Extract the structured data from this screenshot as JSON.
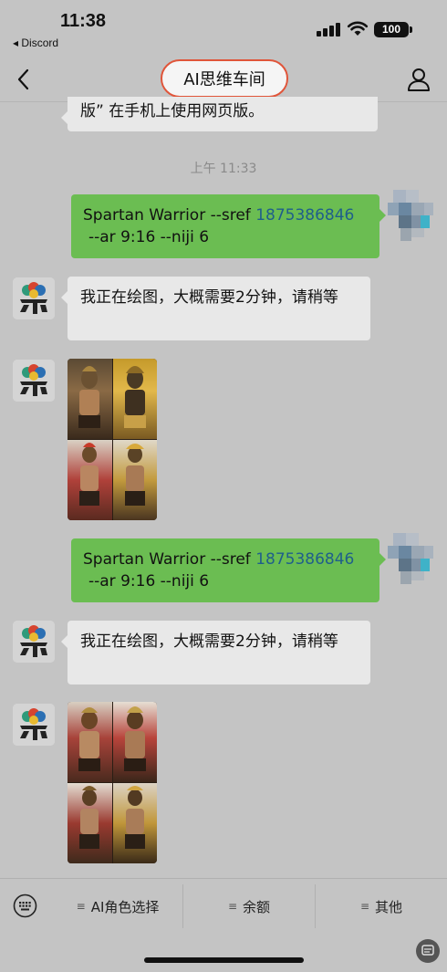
{
  "status_bar": {
    "time": "11:38",
    "back_app": "◂ Discord",
    "battery": "100"
  },
  "nav": {
    "title": "AI思维车间"
  },
  "messages": {
    "prev_text": "版” 在手机上使用网页版。",
    "timestamp": "上午 11:33",
    "out1_line1_a": "Spartan Warrior --sref ",
    "out1_line1_num": "1875386846",
    "out1_line2": "--ar 9:16 --niji 6",
    "in1_text": "我正在绘图，大概需要2分钟，请稍等",
    "out2_line1_a": "Spartan Warrior --sref ",
    "out2_line1_num": "1875386846",
    "out2_line2": "--ar 9:16 --niji 6",
    "in2_text": "我正在绘图，大概需要2分钟，请稍等"
  },
  "bottom_menu": {
    "items": [
      {
        "label": "AI角色选择"
      },
      {
        "label": "余额"
      },
      {
        "label": "其他"
      }
    ]
  },
  "colors": {
    "background": "#c4c4c4",
    "outgoing_bubble": "#6bbd52",
    "incoming_bubble": "#e8e8e8",
    "title_highlight": "#e0553a"
  },
  "icons": [
    "chevron-left-icon",
    "user-icon",
    "keyboard-icon",
    "signal-icon",
    "wifi-icon",
    "battery-icon"
  ]
}
